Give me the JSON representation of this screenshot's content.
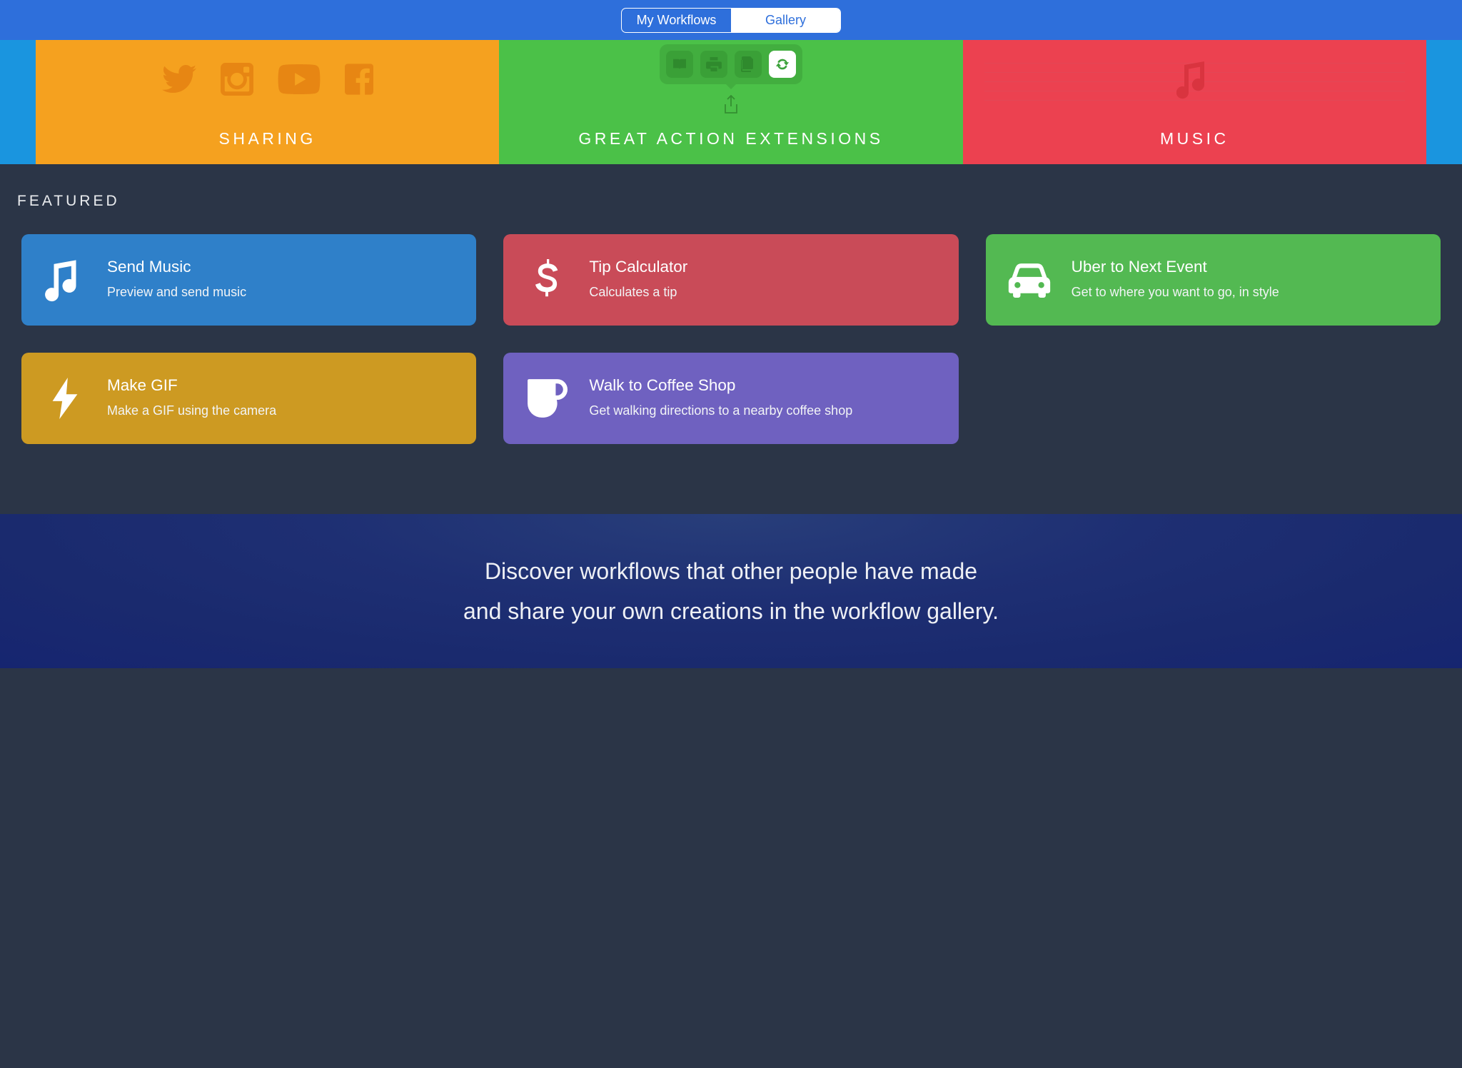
{
  "nav": {
    "tabs": [
      {
        "label": "My Workflows",
        "active": false
      },
      {
        "label": "Gallery",
        "active": true
      }
    ]
  },
  "hero": {
    "items": [
      {
        "label": "SHARING"
      },
      {
        "label": "GREAT ACTION EXTENSIONS"
      },
      {
        "label": "MUSIC"
      }
    ]
  },
  "featured": {
    "heading": "FEATURED",
    "cards": [
      {
        "title": "Send Music",
        "subtitle": "Preview and send music",
        "color": "blue"
      },
      {
        "title": "Tip Calculator",
        "subtitle": "Calculates a tip",
        "color": "red"
      },
      {
        "title": "Uber to Next Event",
        "subtitle": "Get to where you want to go, in style",
        "color": "green"
      },
      {
        "title": "Make GIF",
        "subtitle": "Make a GIF using the camera",
        "color": "gold"
      },
      {
        "title": "Walk to Coffee Shop",
        "subtitle": "Get walking directions to a nearby coffee shop",
        "color": "purple"
      }
    ]
  },
  "tagline": {
    "text": "Discover workflows that other people have made\nand share your own creations in the workflow gallery."
  },
  "colors": {
    "brand_blue": "#2e6fdb",
    "hero_bg_left_right": "#1a95df",
    "dark_bg": "#2b3547"
  }
}
